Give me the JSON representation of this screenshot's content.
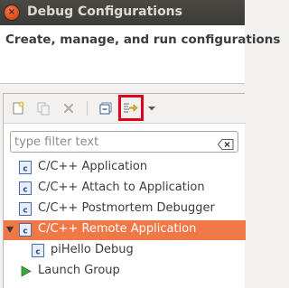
{
  "window": {
    "title": "Debug Configurations",
    "close_glyph": "×"
  },
  "header": {
    "title": "Create, manage, and run configurations"
  },
  "toolbar": {
    "buttons": [
      {
        "name": "new-launch-configuration-icon",
        "enabled": true
      },
      {
        "name": "duplicate-icon",
        "enabled": false
      },
      {
        "name": "delete-icon",
        "enabled": false
      },
      {
        "name": "collapse-all-icon",
        "enabled": true
      },
      {
        "name": "filter-launch-configurations-icon",
        "enabled": true,
        "highlighted": true
      },
      {
        "name": "view-menu-chevron-down-icon",
        "enabled": true
      }
    ],
    "highlight_color": "#e3001b"
  },
  "filter": {
    "value": "",
    "placeholder": "type filter text"
  },
  "tree": {
    "items": [
      {
        "label": "C/C++ Application",
        "icon": "c-config-icon",
        "selected": false
      },
      {
        "label": "C/C++ Attach to Application",
        "icon": "c-config-icon",
        "selected": false
      },
      {
        "label": "C/C++ Postmortem Debugger",
        "icon": "c-config-icon",
        "selected": false
      },
      {
        "label": "C/C++ Remote Application",
        "icon": "c-config-icon",
        "selected": true,
        "expanded": true
      },
      {
        "label": "piHello Debug",
        "icon": "c-config-icon",
        "selected": false
      },
      {
        "label": "Launch Group",
        "icon": "launch-group-icon",
        "selected": false
      }
    ]
  },
  "colors": {
    "selection": "#f07746",
    "titlebar": "#3c3b37",
    "title_text": "#dfdbd2"
  }
}
